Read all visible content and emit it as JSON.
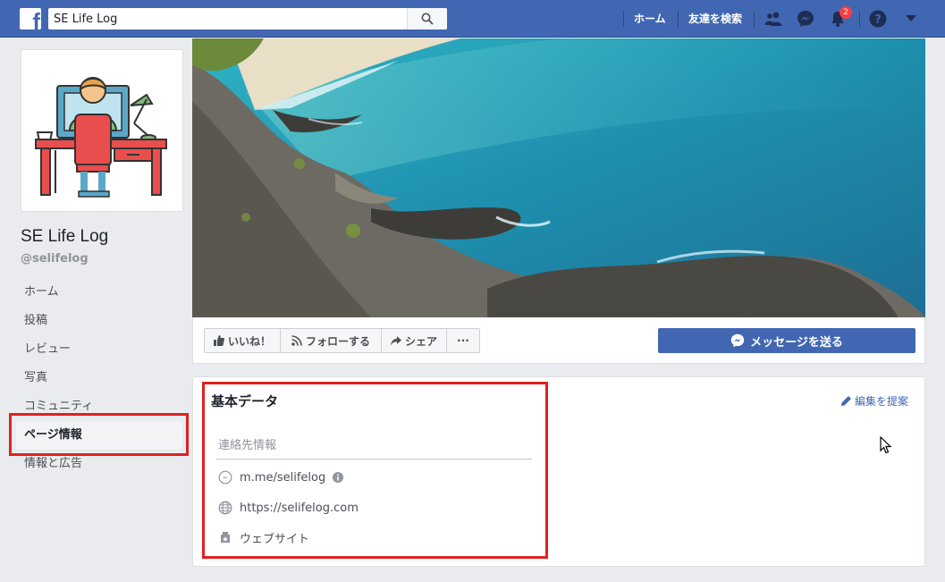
{
  "header": {
    "search_value": "SE Life Log",
    "nav": {
      "home": "ホーム",
      "find_friends": "友達を検索"
    },
    "notification_count": "2"
  },
  "page": {
    "name": "SE Life Log",
    "handle": "@selifelog"
  },
  "sidebar": {
    "items": [
      {
        "label": "ホーム"
      },
      {
        "label": "投稿"
      },
      {
        "label": "レビュー"
      },
      {
        "label": "写真"
      },
      {
        "label": "コミュニティ"
      },
      {
        "label": "ページ情報"
      },
      {
        "label": "情報と広告"
      }
    ]
  },
  "actions": {
    "like": "いいね！",
    "follow": "フォローする",
    "share": "シェア",
    "more": "···",
    "message": "メッセージを送る"
  },
  "about": {
    "title": "基本データ",
    "suggest_edit": "編集を提案",
    "contact_header": "連絡先情報",
    "messenger": "m.me/selifelog",
    "website_url": "https://selifelog.com",
    "website_label": "ウェブサイト"
  },
  "colors": {
    "brand": "#4267b2",
    "highlight": "#e02020"
  }
}
